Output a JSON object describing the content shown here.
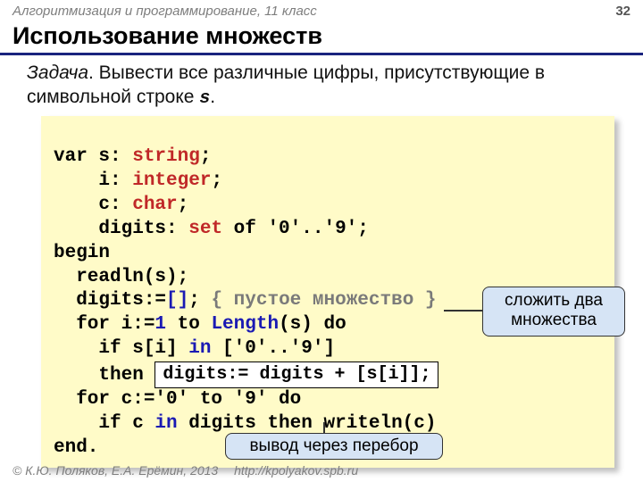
{
  "header": {
    "course": "Алгоритмизация и программирование, 11 класс",
    "page": "32"
  },
  "title": "Использование множеств",
  "task": {
    "label": "Задача",
    "text": ". Вывести все различные цифры, присутствующие в символьной строке ",
    "var": "s",
    "tail": "."
  },
  "code": {
    "l1a": "var s: ",
    "l1b": "string",
    "l1c": ";",
    "l2a": "    i: ",
    "l2b": "integer",
    "l2c": ";",
    "l3a": "    c: ",
    "l3b": "char",
    "l3c": ";",
    "l4a": "    digits: ",
    "l4b": "set",
    "l4c": " of '0'..'9';",
    "l5": "begin",
    "l6": "  readln(s);",
    "l7a": "  digits:=",
    "l7b": "[]",
    "l7c": "; ",
    "l7d": "{ пустое множество }",
    "l8a": "  for i:=",
    "l8b": "1",
    "l8c": " to ",
    "l8d": "Length",
    "l8e": "(s) do",
    "l9a": "    if s[i] ",
    "l9b": "in",
    "l9c": " ['0'..'9']",
    "l10a": "    then ",
    "inset": "digits:= digits + [s[i]];",
    "l11": "  for c:='0' to '9' do",
    "l12a": "    if c ",
    "l12b": "in",
    "l12c": " digits then writeln(c)",
    "l13": "end."
  },
  "callouts": {
    "merge": "сложить два\nмножества",
    "iterate": "вывод через перебор"
  },
  "footer": {
    "copy": "© К.Ю. Поляков, Е.А. Ерёмин, 2013",
    "url": "http://kpolyakov.spb.ru"
  }
}
